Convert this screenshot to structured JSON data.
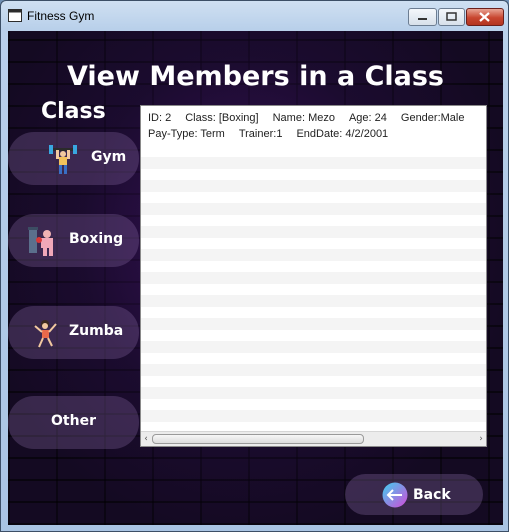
{
  "window": {
    "title": "Fitness Gym"
  },
  "page": {
    "heading": "View Members in a Class",
    "class_label": "Class"
  },
  "class_buttons": [
    {
      "label": "Gym",
      "icon": "weightlifter-icon"
    },
    {
      "label": "Boxing",
      "icon": "boxer-icon"
    },
    {
      "label": "Zumba",
      "icon": "dancer-icon"
    },
    {
      "label": "Other",
      "icon": ""
    }
  ],
  "record": {
    "line1": [
      "ID: 2",
      "Class: [Boxing]",
      "Name: Mezo",
      "Age: 24",
      "Gender:Male"
    ],
    "line2": [
      "Pay-Type: Term",
      "Trainer:1",
      "EndDate: 4/2/2001"
    ]
  },
  "back_button": {
    "label": "Back"
  }
}
